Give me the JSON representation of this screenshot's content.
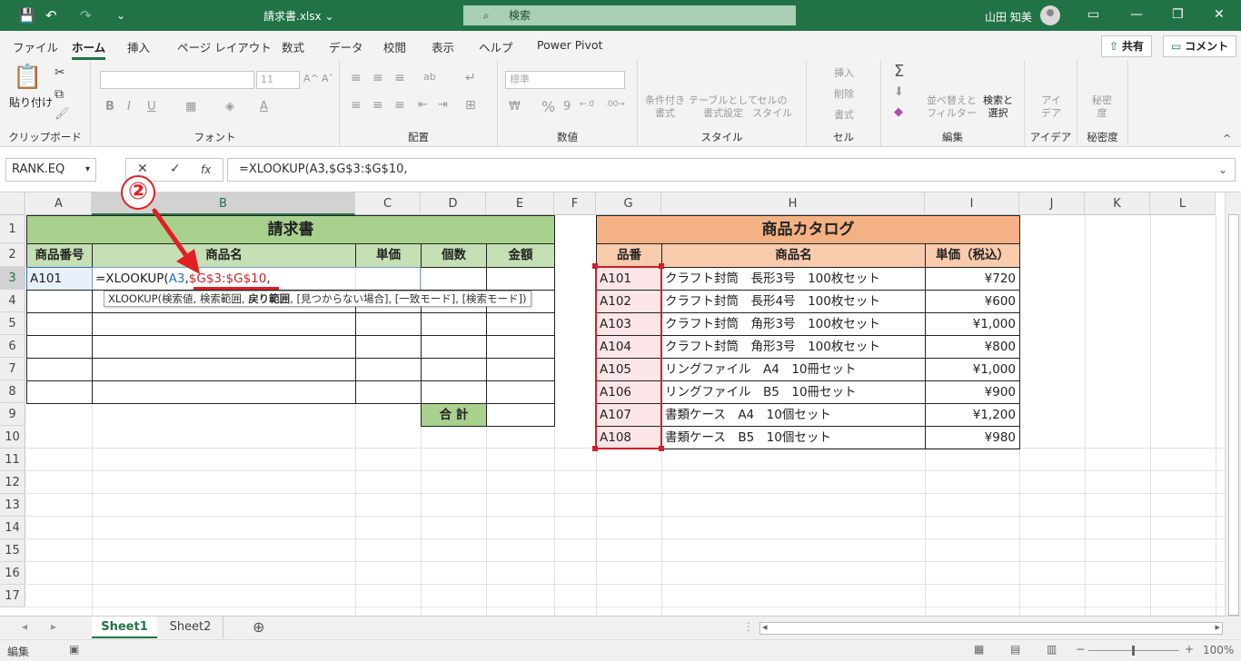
{
  "titlebar": {
    "filename": "請求書.xlsx",
    "search_placeholder": "検索",
    "user_name": "山田 知美",
    "save_icon": "💾",
    "undo_icon": "↶",
    "redo_icon": "↷",
    "customize_icon": "⌄",
    "dropdown_icon": "⌄",
    "search_icon": "⌕",
    "layout_icon": "▭",
    "minimize_icon": "—",
    "restore_icon": "❐",
    "close_icon": "✕"
  },
  "menu": {
    "tabs": [
      "ファイル",
      "ホーム",
      "挿入",
      "ページ レイアウト",
      "数式",
      "データ",
      "校閲",
      "表示",
      "ヘルプ",
      "Power Pivot"
    ],
    "active_index": 1,
    "share_label": "共有",
    "share_icon": "⇧",
    "comment_label": "コメント",
    "comment_icon": "▭"
  },
  "ribbon": {
    "clipboard": {
      "label": "クリップボード",
      "paste_label": "貼り付け",
      "paste_icon": "📋",
      "cut_icon": "✂",
      "copy_icon": "⧉",
      "painter_icon": "🖌"
    },
    "font": {
      "label": "フォント",
      "font_name": "",
      "font_size": "11",
      "bold": "B",
      "italic": "I",
      "underline": "U",
      "grow": "A^",
      "shrink": "Aˇ",
      "border_icon": "▦",
      "fill_icon": "◈",
      "color_icon": "A"
    },
    "align": {
      "label": "配置",
      "top": "≡",
      "middle": "≡",
      "bottom": "≡",
      "left": "≡",
      "center": "≡",
      "right": "≡",
      "wrap_icon": "↵",
      "merge_icon": "⊞",
      "orient_icon": "ab",
      "indent_dec": "⇤",
      "indent_inc": "⇥"
    },
    "number": {
      "label": "数値",
      "format": "標準",
      "currency": "₩",
      "percent": "%",
      "comma": "9",
      "inc_dec": "←.0",
      "dec_dec": ".00→"
    },
    "styles": {
      "label": "スタイル",
      "cond": "条件付き\n書式",
      "table": "テーブルとして\n書式設定",
      "cell": "セルの\nスタイル"
    },
    "cells": {
      "label": "セル",
      "insert": "挿入",
      "delete": "削除",
      "format": "書式"
    },
    "editing": {
      "label": "編集",
      "sum_icon": "Σ",
      "fill_icon": "⬇",
      "clear_icon": "◆",
      "sort": "並べ替えと\nフィルター",
      "find": "検索と\n選択"
    },
    "ideas": {
      "label": "アイデア",
      "btn": "アイ\nデア"
    },
    "sensitivity": {
      "label": "秘密度",
      "btn": "秘密\n度"
    },
    "collapse_icon": "^"
  },
  "formula_bar": {
    "name_box": "RANK.EQ",
    "name_dropdown_icon": "▾",
    "cancel_icon": "✕",
    "enter_icon": "✓",
    "fx_icon": "fx",
    "formula": "=XLOOKUP(A3,$G$3:$G$10,",
    "expand_icon": "⌄"
  },
  "annotation": {
    "step_label": "②"
  },
  "grid": {
    "columns": [
      "A",
      "B",
      "C",
      "D",
      "E",
      "F",
      "G",
      "H",
      "I",
      "J",
      "K",
      "L"
    ],
    "rows": [
      "1",
      "2",
      "3",
      "4",
      "5",
      "6",
      "7",
      "8",
      "9",
      "10",
      "11",
      "12",
      "13",
      "14",
      "15",
      "16",
      "17"
    ],
    "invoice": {
      "title": "請求書",
      "headers": [
        "商品番号",
        "商品名",
        "単価",
        "個数",
        "金額"
      ],
      "a3": "A101",
      "formula_prefix": "=XLOOKUP(",
      "formula_ref1": "A3",
      "formula_comma1": ",",
      "formula_ref2": "$G$3:$G$10",
      "formula_comma2": ",",
      "total_label": "合 計"
    },
    "tooltip": {
      "fn": "XLOOKUP(",
      "args": "検索値, 検索範囲, ",
      "bold_arg": "戻り範囲",
      "rest": ", [見つからない場合], [一致モード], [検索モード])"
    },
    "catalog": {
      "title": "商品カタログ",
      "headers": [
        "品番",
        "商品名",
        "単価（税込）"
      ],
      "rows": [
        {
          "code": "A101",
          "name": "クラフト封筒　長形3号　100枚セット",
          "price": "¥720"
        },
        {
          "code": "A102",
          "name": "クラフト封筒　長形4号　100枚セット",
          "price": "¥600"
        },
        {
          "code": "A103",
          "name": "クラフト封筒　角形3号　100枚セット",
          "price": "¥1,000"
        },
        {
          "code": "A104",
          "name": "クラフト封筒　角形3号　100枚セット",
          "price": "¥800"
        },
        {
          "code": "A105",
          "name": "リングファイル　A4　10冊セット",
          "price": "¥1,000"
        },
        {
          "code": "A106",
          "name": "リングファイル　B5　10冊セット",
          "price": "¥900"
        },
        {
          "code": "A107",
          "name": "書類ケース　A4　10個セット",
          "price": "¥1,200"
        },
        {
          "code": "A108",
          "name": "書類ケース　B5　10個セット",
          "price": "¥980"
        }
      ]
    }
  },
  "sheets": {
    "tabs": [
      "Sheet1",
      "Sheet2"
    ],
    "active_index": 0,
    "add_icon": "⊕",
    "nav_prev": "◂",
    "nav_next": "▸",
    "more_icon": "⋮"
  },
  "status": {
    "mode": "編集",
    "macro_icon": "▣",
    "normal_view_icon": "▦",
    "page_layout_icon": "▤",
    "page_break_icon": "▥",
    "zoom_minus": "−",
    "zoom_plus": "+",
    "zoom": "100%"
  },
  "colors": {
    "excel_green": "#217346",
    "invoice_title": "#a9d18e",
    "invoice_header": "#c5e0b4",
    "catalog_title": "#f4b183",
    "catalog_header": "#f8cbad",
    "ref_blue": "#2f6fc4",
    "ref_red": "#d0202a"
  }
}
